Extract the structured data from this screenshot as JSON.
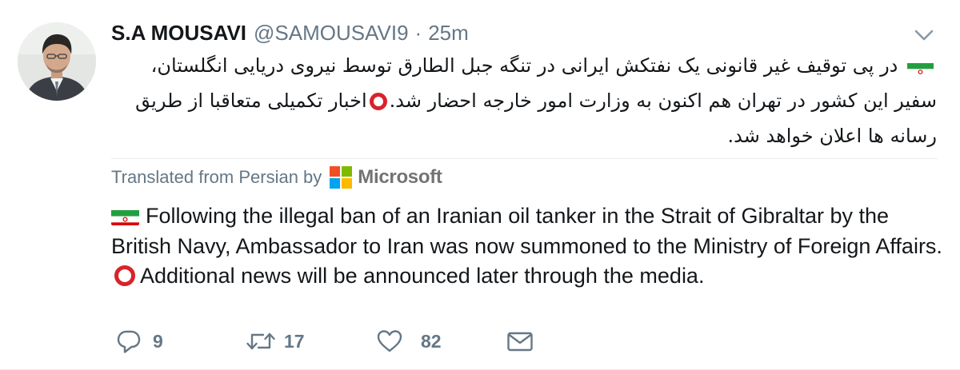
{
  "tweet": {
    "author_name": "S.A MOUSAVI",
    "handle": "@SAMOUSAVI9",
    "separator": "·",
    "time": "25m",
    "persian_lines": [
      "در پی توقیف غیر قانونی یک نفتکش ایرانی در تنگه جبل الطارق توسط نیروی دریایی انگلستان، سفیر این",
      "کشور در تهران هم اکنون به وزارت امور خارجه احضار شد.",
      "اخبار تکمیلی متعاقبا از طریق رسانه ها اعلان",
      "خواهد شد."
    ],
    "translated_label": "Translated from Persian by",
    "translator": "Microsoft",
    "english_part1": "Following the illegal ban of an Iranian oil tanker in the Strait of Gibraltar by the British Navy, Ambassador to Iran was now summoned to the Ministry of Foreign Affairs.",
    "english_part2": "Additional news will be announced later through the media.",
    "flag_icon": "iran-flag-icon",
    "circle_icon": "red-circle-icon"
  },
  "actions": {
    "reply_count": "9",
    "retweet_count": "17",
    "like_count": "82",
    "reply_icon": "reply-icon",
    "retweet_icon": "retweet-icon",
    "like_icon": "heart-icon",
    "dm_icon": "envelope-icon"
  },
  "colors": {
    "text": "#14171a",
    "secondary": "#657786",
    "divider": "#e6ecf0",
    "circle_red": "#d8232a",
    "flag_green": "#239f40",
    "flag_red": "#da0000",
    "ms_orange": "#f25022",
    "ms_green": "#7fba00",
    "ms_blue": "#00a4ef",
    "ms_yellow": "#ffb900"
  }
}
